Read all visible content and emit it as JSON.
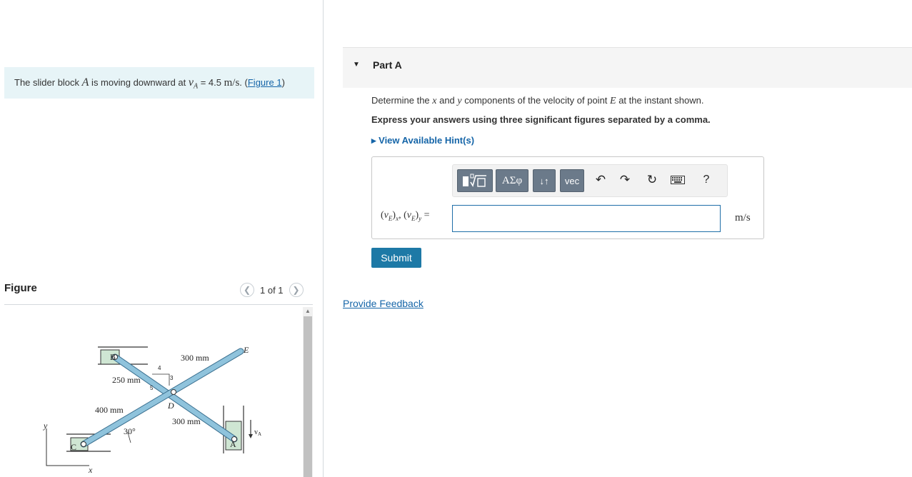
{
  "problem": {
    "text_before": "The slider block ",
    "var_block": "A",
    "text_mid": " is moving downward at ",
    "var_v": "v",
    "var_sub": "A",
    "text_eq": " = 4.5 ",
    "unit": "m/s",
    "text_period": ". (",
    "figure_link": "Figure 1",
    "text_close": ")"
  },
  "figure": {
    "label": "Figure",
    "prev_icon": "chevron-left-icon",
    "next_icon": "chevron-right-icon",
    "counter": "1 of 1",
    "labels": {
      "B": "B",
      "C": "C",
      "D": "D",
      "E": "E",
      "A": "A",
      "len_250": "250 mm",
      "len_400": "400 mm",
      "len_300_top": "300 mm",
      "len_300_bot": "300 mm",
      "angle": "30°",
      "tri_4": "4",
      "tri_3": "3",
      "tri_5": "5",
      "axis_y": "y",
      "axis_x": "x",
      "vel_v": "v",
      "vel_sub": "A"
    }
  },
  "part": {
    "caret_icon": "caret-down-icon",
    "title": "Part A",
    "question_before": "Determine the ",
    "var_x": "x",
    "question_and": " and ",
    "var_y": "y",
    "question_mid": " components of the velocity of point ",
    "var_E": "E",
    "question_end": " at the instant shown.",
    "instruction": "Express your answers using three significant figures separated by a comma.",
    "hint_link": "▸  View Available Hint(s)",
    "toolbar": {
      "templates_icon": "templates-icon",
      "greek_label": "ΑΣφ",
      "arrows_label": "↓↑",
      "vec_label": "vec",
      "undo_icon": "undo-icon",
      "redo_icon": "redo-icon",
      "reset_icon": "reset-icon",
      "keyboard_icon": "keyboard-icon",
      "help_label": "?"
    },
    "answer_label": "(vE)x, (vE)y =",
    "answer_value": "",
    "unit": "m/s",
    "submit_label": "Submit"
  },
  "feedback_link": "Provide Feedback",
  "colors": {
    "problem_bg": "#e7f4f7",
    "link": "#1565a8",
    "submit_bg": "#1d79a6",
    "toolbar_btn": "#6b7a8a",
    "rod_fill": "#8fc3dc",
    "slot_fill": "#cfe6d3"
  }
}
